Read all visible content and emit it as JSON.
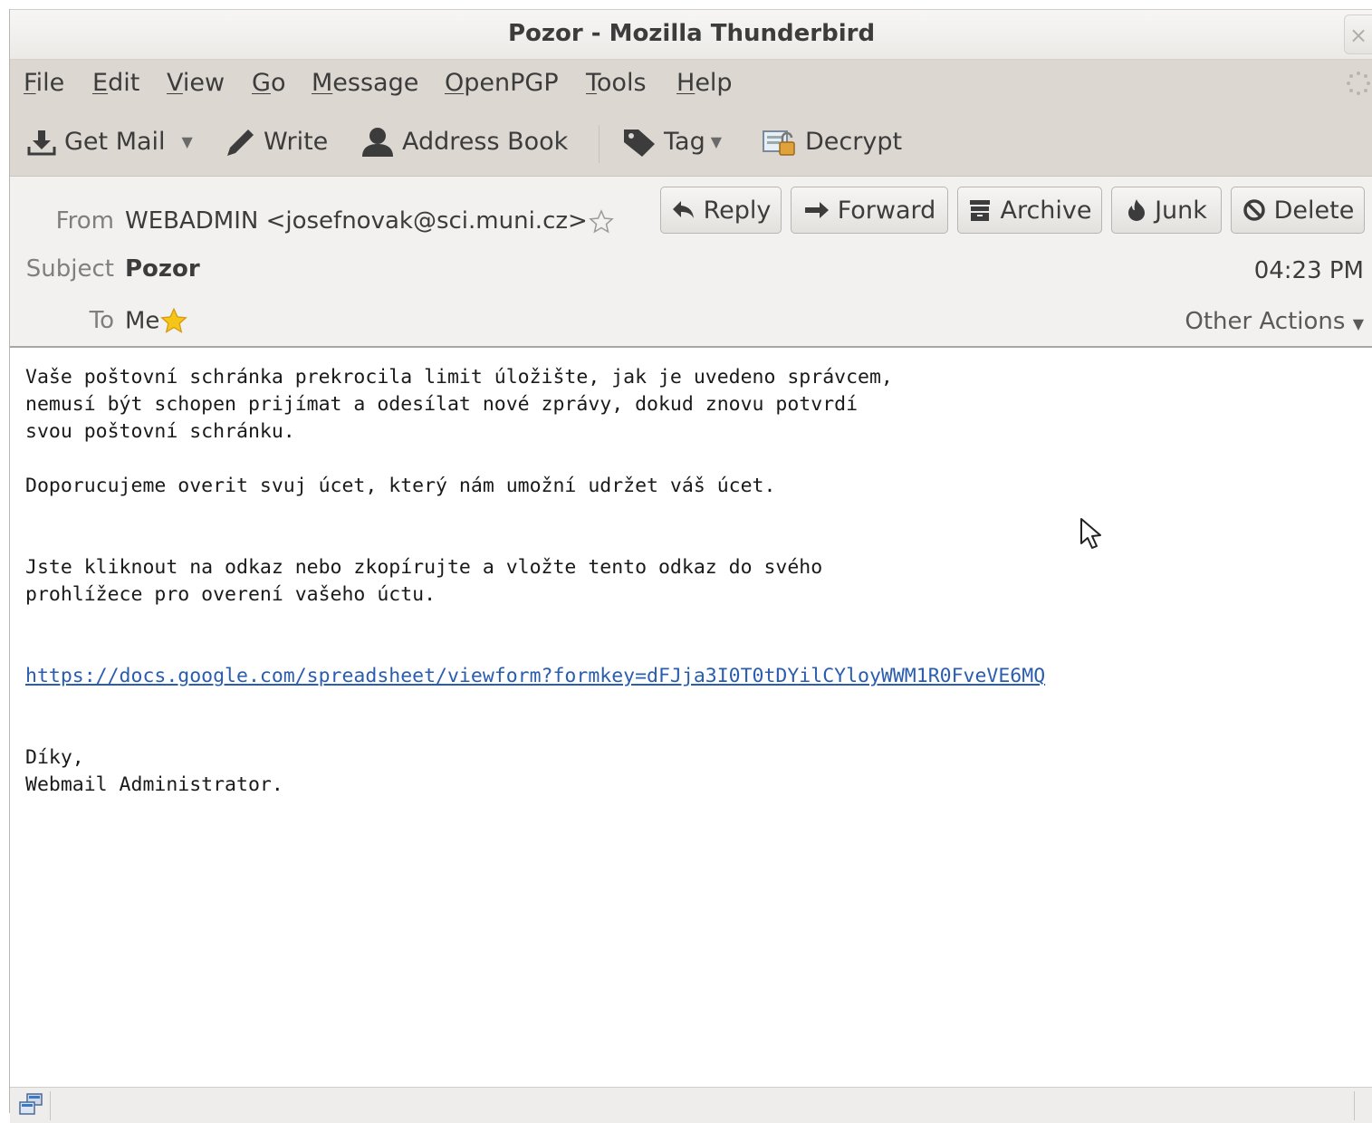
{
  "window": {
    "title": "Pozor - Mozilla Thunderbird",
    "close_glyph": "×"
  },
  "menubar": {
    "items": [
      {
        "label": "File",
        "mnemonic": "F",
        "rest": "ile"
      },
      {
        "label": "Edit",
        "mnemonic": "E",
        "rest": "dit"
      },
      {
        "label": "View",
        "mnemonic": "V",
        "rest": "iew"
      },
      {
        "label": "Go",
        "mnemonic": "G",
        "rest": "o"
      },
      {
        "label": "Message",
        "mnemonic": "M",
        "rest": "essage"
      },
      {
        "label": "OpenPGP",
        "mnemonic": "O",
        "rest": "penPGP"
      },
      {
        "label": "Tools",
        "mnemonic": "T",
        "rest": "ools"
      },
      {
        "label": "Help",
        "mnemonic": "H",
        "rest": "elp"
      }
    ]
  },
  "toolbar": {
    "get_mail": "Get Mail",
    "write": "Write",
    "address_book": "Address Book",
    "tag": "Tag",
    "decrypt": "Decrypt"
  },
  "header": {
    "from_label": "From",
    "from_value": "WEBADMIN <josefnovak@sci.muni.cz>",
    "subject_label": "Subject",
    "subject_value": "Pozor",
    "to_label": "To",
    "to_value": "Me",
    "time": "04:23 PM",
    "other_actions": "Other Actions",
    "buttons": {
      "reply": "Reply",
      "forward": "Forward",
      "archive": "Archive",
      "junk": "Junk",
      "delete": "Delete"
    }
  },
  "message": {
    "p1": "Vaše poštovní schránka prekrocila limit úložište, jak je uvedeno správcem,\nnemusí být schopen prijímat a odesílat nové zprávy, dokud znovu potvrdí\nsvou poštovní schránku.",
    "p2": "Doporucujeme overit svuj úcet, který nám umožní udržet váš úcet.",
    "p3": "Jste kliknout na odkaz nebo zkopírujte a vložte tento odkaz do svého\nprohlížece pro overení vašeho úctu.",
    "link": "https://docs.google.com/spreadsheet/viewform?formkey=dFJja3I0T0tDYilCYloyWWM1R0FveVE6MQ",
    "signoff": "Díky,\nWebmail Administrator."
  },
  "colors": {
    "link": "#2a5db0",
    "star": "#f5c518",
    "chrome": "#dcd7d1"
  }
}
